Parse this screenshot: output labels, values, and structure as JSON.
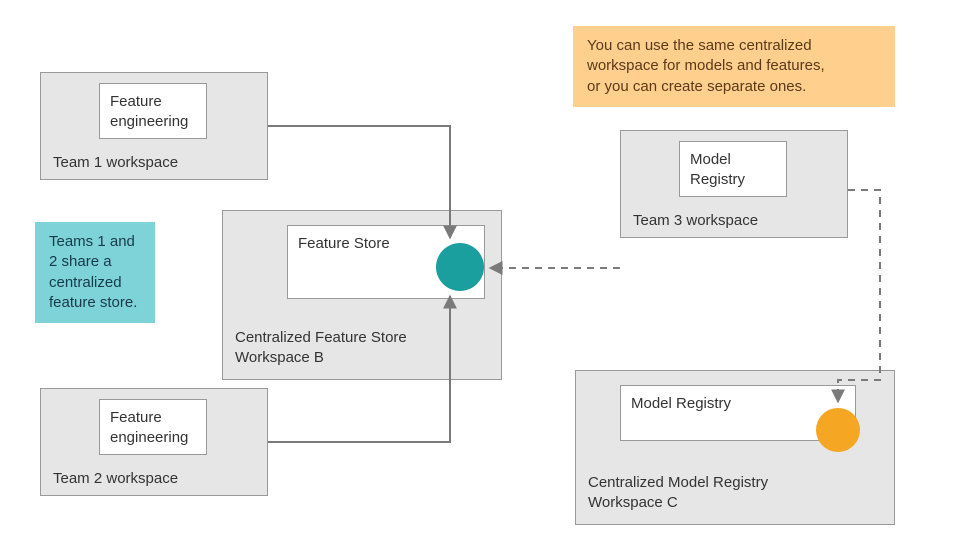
{
  "workspaces": {
    "team1": {
      "label": "Team 1 workspace",
      "inner": "Feature\nengineering"
    },
    "team2": {
      "label": "Team 2 workspace",
      "inner": "Feature\nengineering"
    },
    "team3": {
      "label": "Team 3 workspace",
      "inner": "Model\nRegistry"
    },
    "feature_store": {
      "label": "Centralized Feature Store\nWorkspace B",
      "inner": "Feature Store"
    },
    "model_registry": {
      "label": "Centralized Model Registry\nWorkspace C",
      "inner": "Model Registry"
    }
  },
  "notes": {
    "teal": "Teams 1 and\n2 share a\ncentralized\nfeature store.",
    "orange": "You can use the same centralized\nworkspace for models and features,\nor you can create separate ones."
  }
}
